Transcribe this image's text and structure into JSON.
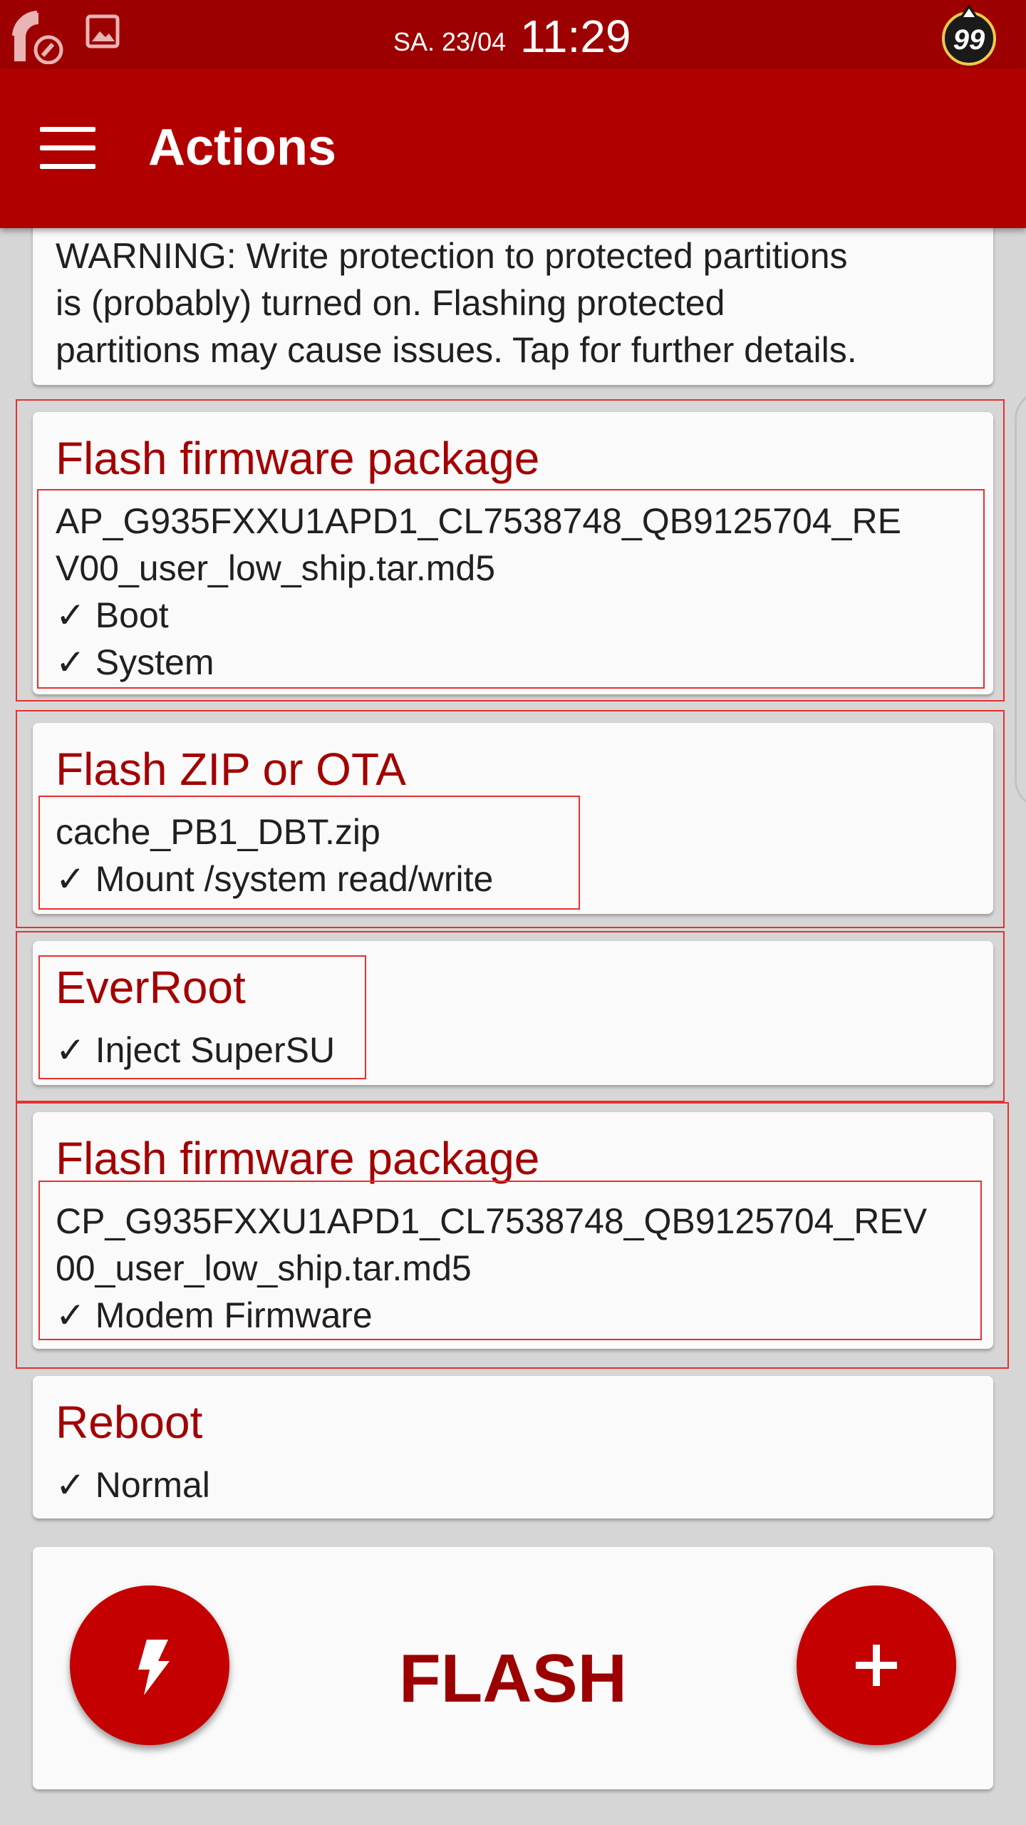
{
  "status_bar": {
    "date": "SA. 23/04",
    "time": "11:29",
    "battery_level": "99",
    "icons": [
      "signal-icon",
      "image-notification-icon",
      "battery-badge-icon"
    ]
  },
  "app_bar": {
    "title": "Actions",
    "menu_icon": "hamburger-menu-icon"
  },
  "warning": {
    "lines": [
      "WARNING: Write protection to protected partitions",
      "is (probably) turned on. Flashing protected",
      "partitions may cause issues. Tap for further details."
    ]
  },
  "actions": [
    {
      "title": "Flash firmware package",
      "lines": [
        "AP_G935FXXU1APD1_CL7538748_QB9125704_RE",
        "V00_user_low_ship.tar.md5",
        "✓ Boot",
        "✓ System"
      ]
    },
    {
      "title": "Flash ZIP or OTA",
      "lines": [
        "cache_PB1_DBT.zip",
        "✓ Mount /system read/write"
      ]
    },
    {
      "title": "EverRoot",
      "lines": [
        "✓ Inject SuperSU"
      ]
    },
    {
      "title": "Flash firmware package",
      "lines": [
        "CP_G935FXXU1APD1_CL7538748_QB9125704_REV",
        "00_user_low_ship.tar.md5",
        "✓ Modem Firmware"
      ]
    },
    {
      "title": "Reboot",
      "lines": [
        "✓ Normal"
      ]
    }
  ],
  "flash_panel": {
    "label": "FLASH",
    "left_button_icon": "lightning-bolt-icon",
    "right_button_icon": "plus-icon"
  },
  "colors": {
    "status_bar": "#9c0000",
    "app_bar": "#b00000",
    "accent_text": "#a30000",
    "fab": "#c40000",
    "highlight_outline": "#e53030"
  }
}
